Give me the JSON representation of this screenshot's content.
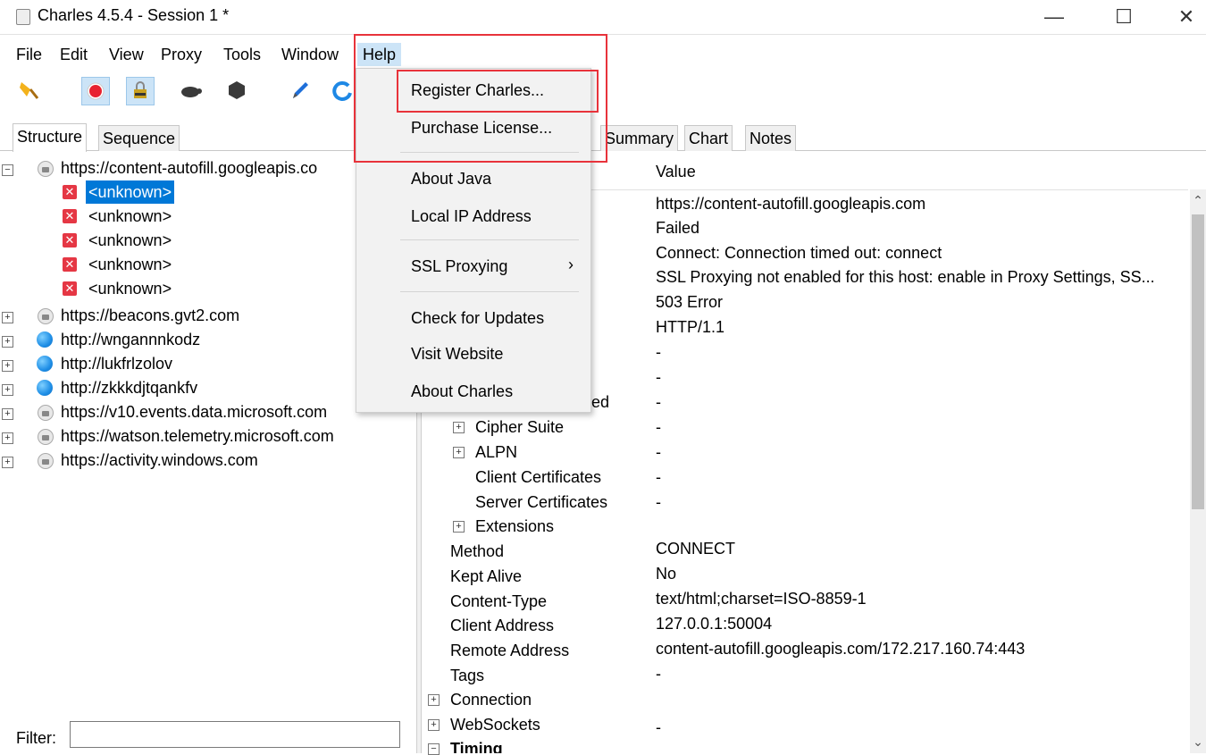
{
  "window": {
    "title": "Charles 4.5.4 - Session 1 *",
    "minimize": "—",
    "maximize": "☐",
    "close": "✕"
  },
  "menubar": [
    "File",
    "Edit",
    "View",
    "Proxy",
    "Tools",
    "Window",
    "Help"
  ],
  "help_menu": {
    "items": [
      "Register Charles...",
      "Purchase License...",
      "About Java",
      "Local IP Address",
      "SSL Proxying",
      "Check for Updates",
      "Visit Website",
      "About Charles"
    ],
    "submenu_arrow": "›"
  },
  "left_tabs": [
    "Structure",
    "Sequence"
  ],
  "tree": {
    "root": "https://content-autofill.googleapis.co",
    "children": [
      "<unknown>",
      "<unknown>",
      "<unknown>",
      "<unknown>",
      "<unknown>"
    ],
    "hosts": [
      "https://beacons.gvt2.com",
      "http://wngannnkodz",
      "http://lukfrlzolov",
      "http://zkkkdjtqankfv",
      "https://v10.events.data.microsoft.com",
      "https://watson.telemetry.microsoft.com",
      "https://activity.windows.com"
    ]
  },
  "filter": {
    "label": "Filter:",
    "value": ""
  },
  "right_tabs": [
    "Summary",
    "Chart",
    "Notes"
  ],
  "table_header": {
    "value": "Value"
  },
  "values_top": [
    "https://content-autofill.googleapis.com",
    "Failed",
    "Connect: Connection timed out: connect",
    "SSL Proxying not enabled for this host: enable in Proxy Settings, SS...",
    "503 Error",
    "HTTP/1.1",
    "-",
    "-",
    "-"
  ],
  "partial_key": "ed",
  "rows": [
    {
      "key": "Cipher Suite",
      "value": "-",
      "expand": "+"
    },
    {
      "key": "ALPN",
      "value": "-",
      "expand": "+"
    },
    {
      "key": "Client Certificates",
      "value": "-"
    },
    {
      "key": "Server Certificates",
      "value": "-"
    },
    {
      "key": "Extensions",
      "value": "",
      "expand": "+"
    },
    {
      "key": "Method",
      "value": "CONNECT"
    },
    {
      "key": "Kept Alive",
      "value": "No"
    },
    {
      "key": "Content-Type",
      "value": "text/html;charset=ISO-8859-1"
    },
    {
      "key": "Client Address",
      "value": "127.0.0.1:50004"
    },
    {
      "key": "Remote Address",
      "value": "content-autofill.googleapis.com/172.217.160.74:443"
    },
    {
      "key": "Tags",
      "value": "-"
    },
    {
      "key": "Connection",
      "value": "",
      "expand": "+"
    },
    {
      "key": "WebSockets",
      "value": "-",
      "expand": "+"
    },
    {
      "key": "Timing",
      "value": "",
      "expand": "−"
    }
  ],
  "colors": {
    "selection": "#0078d7",
    "highlight_box": "#e8333b",
    "menu_active": "#cce4f7"
  }
}
